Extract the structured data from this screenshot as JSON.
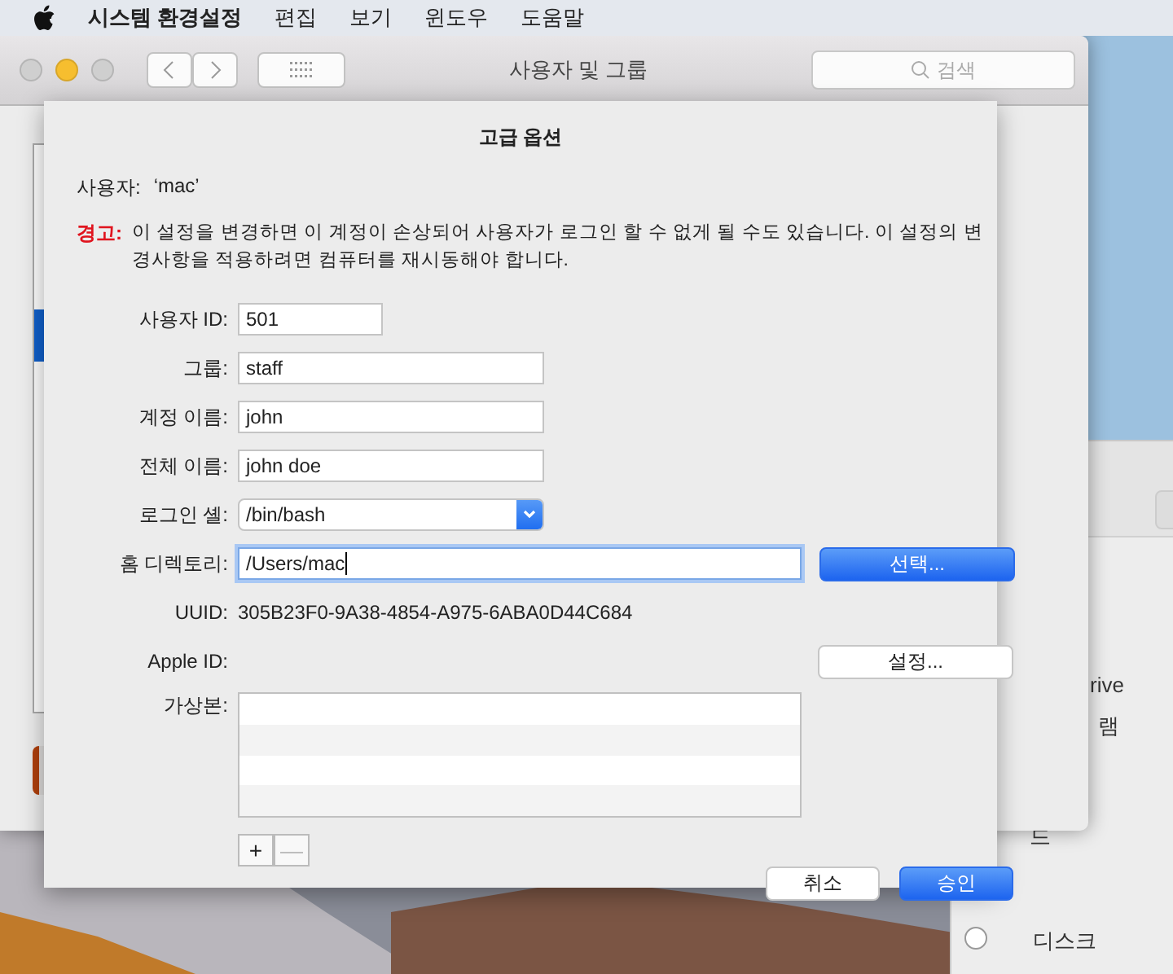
{
  "menu_bar": {
    "app_name": "시스템 환경설정",
    "items": [
      "편집",
      "보기",
      "윈도우",
      "도움말"
    ]
  },
  "window": {
    "title": "사용자 및 그룹",
    "search": {
      "placeholder": "검색"
    }
  },
  "back_window": {
    "texts": [
      "rive",
      "램",
      "드",
      "디스크"
    ],
    "radio": {
      "checked": false
    }
  },
  "sheet": {
    "title": "고급 옵션",
    "user_label": "사용자:",
    "user_value": "‘mac’",
    "warning_label": "경고:",
    "warning_text": "이 설정을 변경하면 이 계정이 손상되어 사용자가 로그인 할 수 없게 될 수도 있습니다. 이 설정의 변경사항을 적용하려면 컴퓨터를 재시동해야 합니다.",
    "fields": [
      {
        "label": "사용자 ID:",
        "kind": "short",
        "value": "501"
      },
      {
        "label": "그룹:",
        "kind": "text",
        "value": "staff"
      },
      {
        "label": "계정 이름:",
        "kind": "text",
        "value": "john"
      },
      {
        "label": "전체 이름:",
        "kind": "text",
        "value": "john doe"
      },
      {
        "label": "로그인 셸:",
        "kind": "popup",
        "value": "/bin/bash"
      },
      {
        "label": "홈 디렉토리:",
        "kind": "path",
        "value": "/Users/mac",
        "focused": true,
        "button": "선택..."
      }
    ],
    "uuid": {
      "label": "UUID:",
      "value": "305B23F0-9A38-4854-A975-6ABA0D44C684"
    },
    "apple_id": {
      "label": "Apple ID:",
      "button": "설정..."
    },
    "aliases": {
      "label": "가상본:",
      "add": "+",
      "remove": "—",
      "remove_disabled": true
    },
    "buttons": [
      {
        "label": "취소",
        "default": false
      },
      {
        "label": "승인",
        "default": true
      }
    ]
  }
}
